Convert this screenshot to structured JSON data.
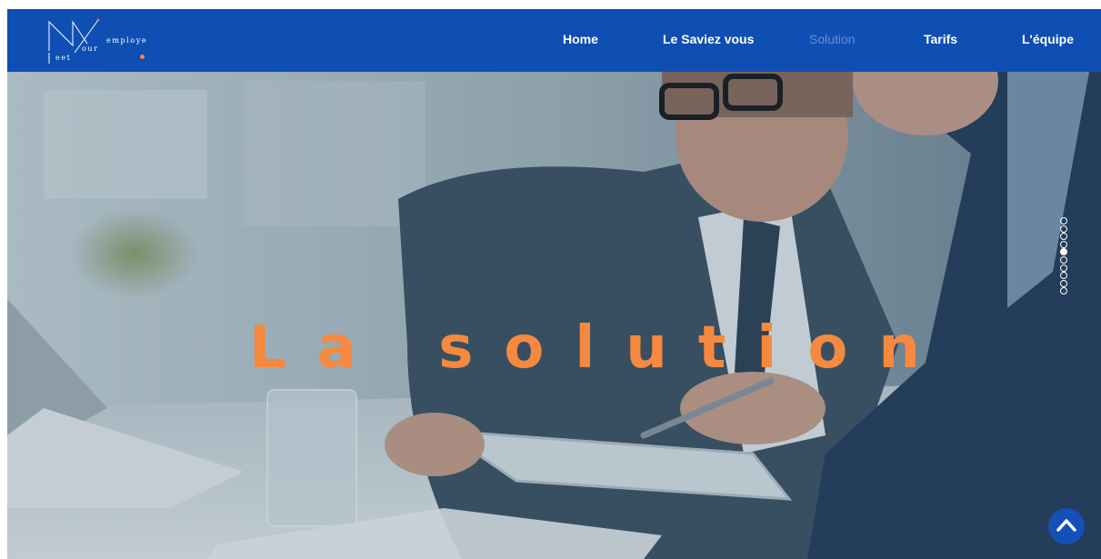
{
  "header": {
    "logo": {
      "text_top": "employe",
      "text_mid": "our",
      "text_bottom": "eet",
      "letters": "MYE",
      "dot_color": "#f08a47"
    },
    "nav": [
      {
        "label": "Home",
        "active": false
      },
      {
        "label": "Le Saviez vous",
        "active": false
      },
      {
        "label": "Solution",
        "active": true
      },
      {
        "label": "Tarifs",
        "active": false
      },
      {
        "label": "L'équipe",
        "active": false
      }
    ],
    "background_color": "#0f4fb4"
  },
  "hero": {
    "title": "La solution",
    "title_color": "#f5893f",
    "image_description_icon": "business-meeting-photo"
  },
  "section_dots": {
    "total": 10,
    "active_index": 4
  },
  "scroll_top": {
    "icon": "chevron-up-icon",
    "color": "#1550b8"
  }
}
